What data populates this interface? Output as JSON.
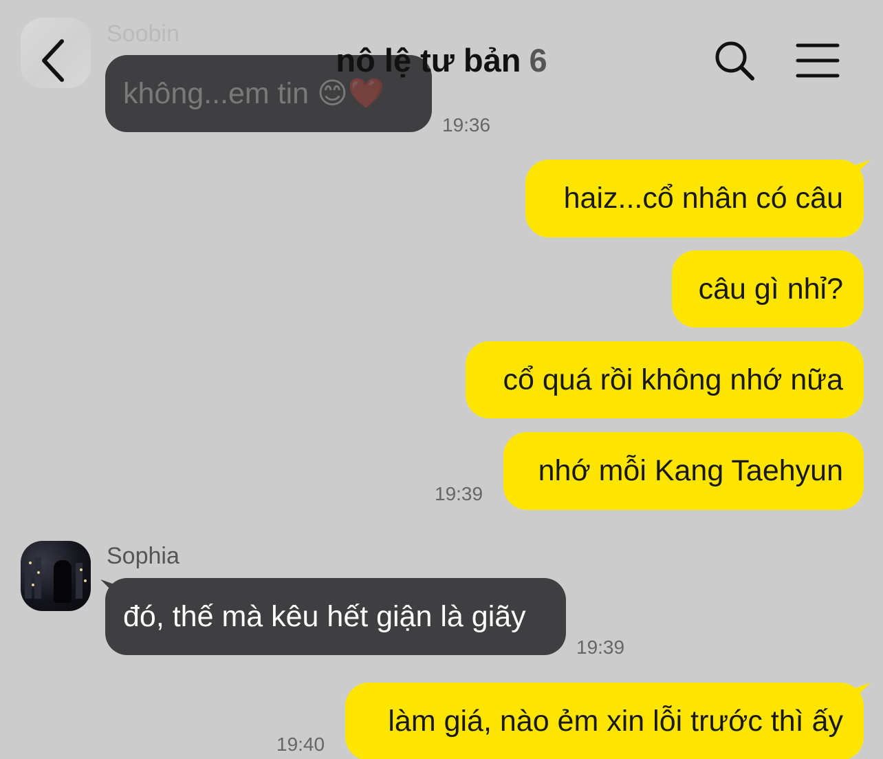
{
  "header": {
    "title": "nô lệ tư bản",
    "member_count": "6",
    "back_icon": "chevron-left-icon",
    "search_icon": "search-icon",
    "menu_icon": "hamburger-menu-icon"
  },
  "messages": [
    {
      "sender": "Soobin",
      "direction": "in",
      "text": "không...em tin 😊❤️",
      "time": "19:36"
    },
    {
      "direction": "out",
      "text": "haiz...cổ nhân có câu"
    },
    {
      "direction": "out",
      "text": "câu gì nhỉ?"
    },
    {
      "direction": "out",
      "text": "cổ quá rồi không nhớ nữa"
    },
    {
      "direction": "out",
      "text": "nhớ mỗi Kang Taehyun",
      "time": "19:39"
    },
    {
      "sender": "Sophia",
      "direction": "in",
      "text": "đó, thế mà kêu hết giận là giãy",
      "time": "19:39"
    },
    {
      "direction": "out",
      "text": "làm giá, nào ẻm xin lỗi trước thì ấy",
      "time": "19:40"
    }
  ],
  "colors": {
    "background": "#cccccc",
    "outgoing_bubble": "#fee500",
    "incoming_bubble": "#3f3f41"
  }
}
